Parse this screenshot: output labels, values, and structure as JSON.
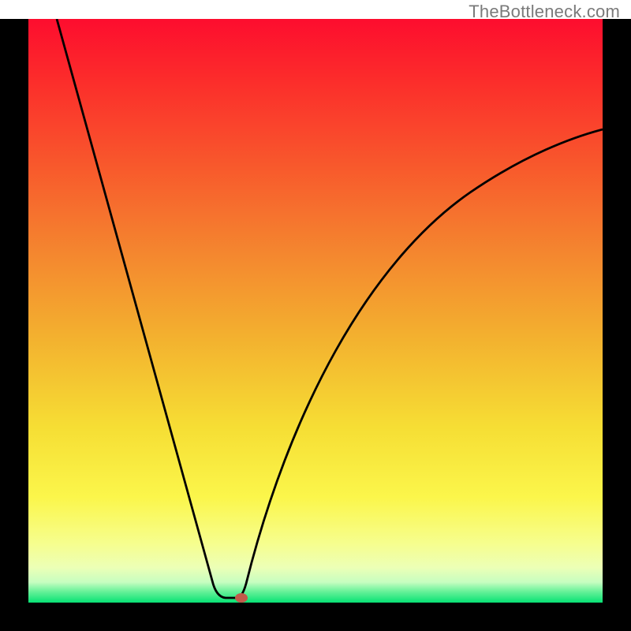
{
  "attribution": "TheBottleneck.com",
  "chart_data": {
    "type": "line",
    "title": "",
    "xlabel": "",
    "ylabel": "",
    "xlim": [
      0,
      100
    ],
    "ylim": [
      0,
      100
    ],
    "grid": false,
    "legend": false,
    "annotations": [
      {
        "kind": "dot",
        "x": 36,
        "y": 1,
        "color": "#c25a4a",
        "meaning": "curve minimum"
      }
    ],
    "background_gradient_stops": [
      {
        "pos": 0.0,
        "color": "#fd0d2e"
      },
      {
        "pos": 0.1,
        "color": "#fc2b2b"
      },
      {
        "pos": 0.25,
        "color": "#f8582c"
      },
      {
        "pos": 0.4,
        "color": "#f4862f"
      },
      {
        "pos": 0.55,
        "color": "#f3b22f"
      },
      {
        "pos": 0.7,
        "color": "#f6de34"
      },
      {
        "pos": 0.82,
        "color": "#fbf64b"
      },
      {
        "pos": 0.9,
        "color": "#f6fe8f"
      },
      {
        "pos": 0.94,
        "color": "#ecffb6"
      },
      {
        "pos": 0.965,
        "color": "#c7fec0"
      },
      {
        "pos": 0.98,
        "color": "#6df29b"
      },
      {
        "pos": 1.0,
        "color": "#07e274"
      }
    ],
    "series": [
      {
        "name": "bottleneck-curve",
        "x": [
          5,
          10,
          15,
          20,
          25,
          30,
          32,
          34,
          36,
          38,
          40,
          45,
          50,
          55,
          60,
          65,
          70,
          75,
          80,
          85,
          90,
          95,
          100
        ],
        "y": [
          100,
          84,
          68,
          52,
          36,
          20,
          10,
          2,
          1,
          3,
          12,
          30,
          44,
          54,
          61,
          66,
          70,
          73,
          76,
          78,
          79.5,
          80.5,
          81
        ]
      }
    ],
    "notes": "Axes are unlabeled in the original image; values on a 0-100 percentage scale are estimated from pixel positions. The curve descends steeply from (5,100) to a flat minimum around x≈33–36, y≈1, then rises with decreasing slope toward (100,~81)."
  }
}
